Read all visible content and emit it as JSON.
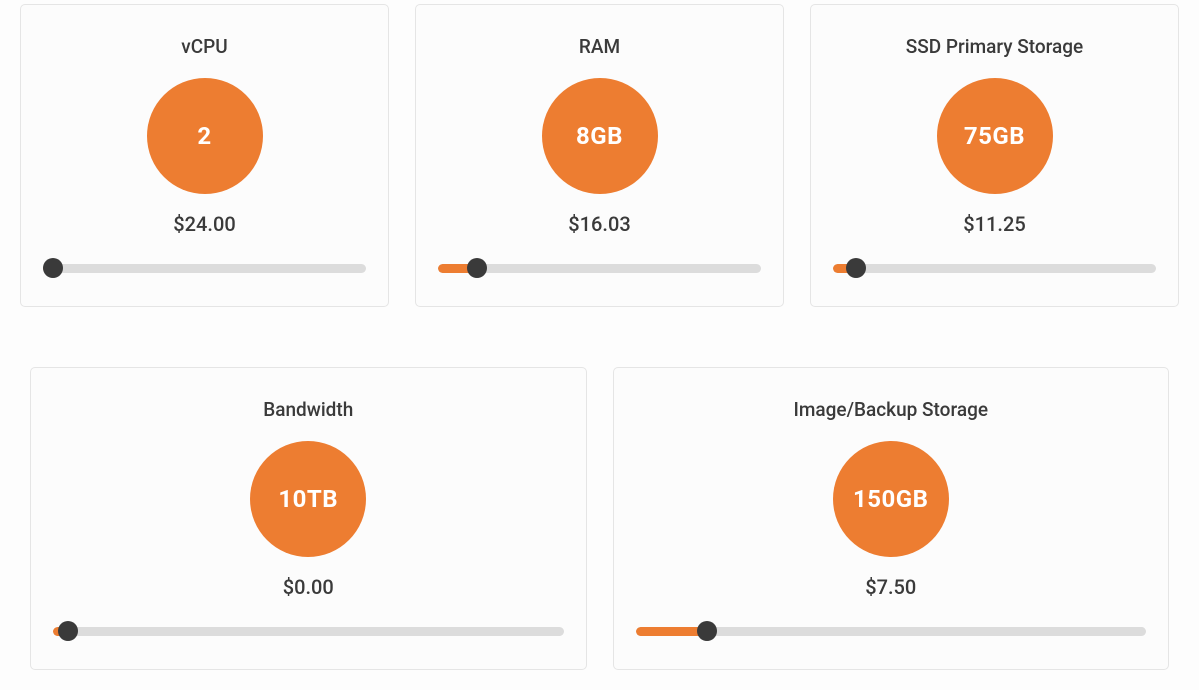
{
  "cards_row1": [
    {
      "title": "vCPU",
      "value": "2",
      "price": "$24.00",
      "slider_percent": 3
    },
    {
      "title": "RAM",
      "value": "8GB",
      "price": "$16.03",
      "slider_percent": 12
    },
    {
      "title": "SSD Primary Storage",
      "value": "75GB",
      "price": "$11.25",
      "slider_percent": 7
    }
  ],
  "cards_row2": [
    {
      "title": "Bandwidth",
      "value": "10TB",
      "price": "$0.00",
      "slider_percent": 3
    },
    {
      "title": "Image/Backup Storage",
      "value": "150GB",
      "price": "$7.50",
      "slider_percent": 14
    }
  ]
}
